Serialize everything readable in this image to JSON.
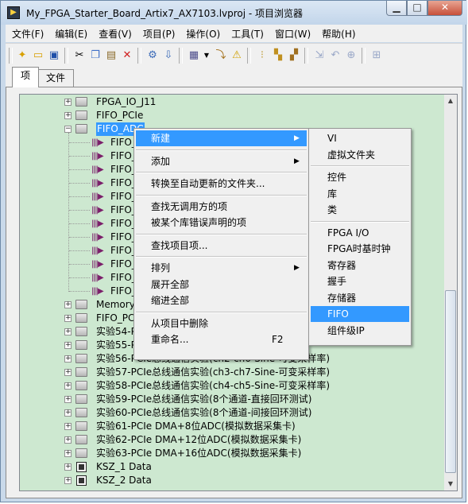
{
  "window": {
    "title": "My_FPGA_Starter_Board_Artix7_AX7103.lvproj - 项目浏览器"
  },
  "menubar": [
    "文件(F)",
    "编辑(E)",
    "查看(V)",
    "项目(P)",
    "操作(O)",
    "工具(T)",
    "窗口(W)",
    "帮助(H)"
  ],
  "tabs": [
    "项",
    "文件"
  ],
  "tree": [
    {
      "label": "FPGA_IO_J11",
      "icon": "folder",
      "exp": "+"
    },
    {
      "label": "FIFO_PCIe",
      "icon": "folder",
      "exp": "+"
    },
    {
      "label": "FIFO_ADC",
      "icon": "folder",
      "exp": "-",
      "selected": true
    },
    {
      "label": "FIFO_A",
      "icon": "vi",
      "exp": ""
    },
    {
      "label": "FIFO_A",
      "icon": "vi",
      "exp": ""
    },
    {
      "label": "FIFO_A",
      "icon": "vi",
      "exp": ""
    },
    {
      "label": "FIFO_A",
      "icon": "vi",
      "exp": ""
    },
    {
      "label": "FIFO_A",
      "icon": "vi",
      "exp": ""
    },
    {
      "label": "FIFO_A",
      "icon": "vi",
      "exp": ""
    },
    {
      "label": "FIFO_A",
      "icon": "vi",
      "exp": ""
    },
    {
      "label": "FIFO_A",
      "icon": "vi",
      "exp": ""
    },
    {
      "label": "FIFO_A",
      "icon": "vi",
      "exp": ""
    },
    {
      "label": "FIFO_A",
      "icon": "vi",
      "exp": ""
    },
    {
      "label": "FIFO_A",
      "icon": "vi",
      "exp": ""
    },
    {
      "label": "FIFO_A",
      "icon": "vi",
      "exp": ""
    },
    {
      "label": "Memory_",
      "icon": "folder",
      "exp": "+"
    },
    {
      "label": "FIFO_PCIe",
      "icon": "folder",
      "exp": "+"
    },
    {
      "label": "实验54-PC",
      "icon": "folder",
      "exp": "+"
    },
    {
      "label": "实验55-PC",
      "icon": "folder",
      "exp": "+"
    },
    {
      "label": "实验56-PCIe总线通信实验(ch2-ch6-Sine-可变采样率)",
      "icon": "folder",
      "exp": "+"
    },
    {
      "label": "实验57-PCIe总线通信实验(ch3-ch7-Sine-可变采样率)",
      "icon": "folder",
      "exp": "+"
    },
    {
      "label": "实验58-PCIe总线通信实验(ch4-ch5-Sine-可变采样率)",
      "icon": "folder",
      "exp": "+"
    },
    {
      "label": "实验59-PCIe总线通信实验(8个通道-直接回环测试)",
      "icon": "folder",
      "exp": "+"
    },
    {
      "label": "实验60-PCIe总线通信实验(8个通道-间接回环测试)",
      "icon": "folder",
      "exp": "+"
    },
    {
      "label": "实验61-PCIe DMA+8位ADC(模拟数据采集卡)",
      "icon": "folder",
      "exp": "+"
    },
    {
      "label": "实验62-PCIe DMA+12位ADC(模拟数据采集卡)",
      "icon": "folder",
      "exp": "+"
    },
    {
      "label": "实验63-PCIe DMA+16位ADC(模拟数据采集卡)",
      "icon": "folder",
      "exp": "+"
    },
    {
      "label": "KSZ_1 Data",
      "icon": "chip",
      "exp": "+"
    },
    {
      "label": "KSZ_2 Data",
      "icon": "chip",
      "exp": "+"
    }
  ],
  "context_menu": [
    {
      "label": "新建",
      "submenu": true,
      "highlight": true
    },
    {
      "sep": true
    },
    {
      "label": "添加",
      "submenu": true
    },
    {
      "sep": true
    },
    {
      "label": "转换至自动更新的文件夹..."
    },
    {
      "sep": true
    },
    {
      "label": "查找无调用方的项"
    },
    {
      "label": "被某个库错误声明的项"
    },
    {
      "sep": true
    },
    {
      "label": "查找项目项..."
    },
    {
      "sep": true
    },
    {
      "label": "排列",
      "submenu": true
    },
    {
      "label": "展开全部"
    },
    {
      "label": "缩进全部"
    },
    {
      "sep": true
    },
    {
      "label": "从项目中删除"
    },
    {
      "label": "重命名...",
      "shortcut": "F2"
    }
  ],
  "submenu": [
    {
      "label": "VI"
    },
    {
      "label": "虚拟文件夹"
    },
    {
      "sep": true
    },
    {
      "label": "控件"
    },
    {
      "label": "库"
    },
    {
      "label": "类"
    },
    {
      "sep": true
    },
    {
      "label": "FPGA I/O"
    },
    {
      "label": "FPGA时基时钟"
    },
    {
      "label": "寄存器"
    },
    {
      "label": "握手"
    },
    {
      "label": "存储器"
    },
    {
      "label": "FIFO",
      "highlight": true
    },
    {
      "label": "组件级IP"
    }
  ]
}
